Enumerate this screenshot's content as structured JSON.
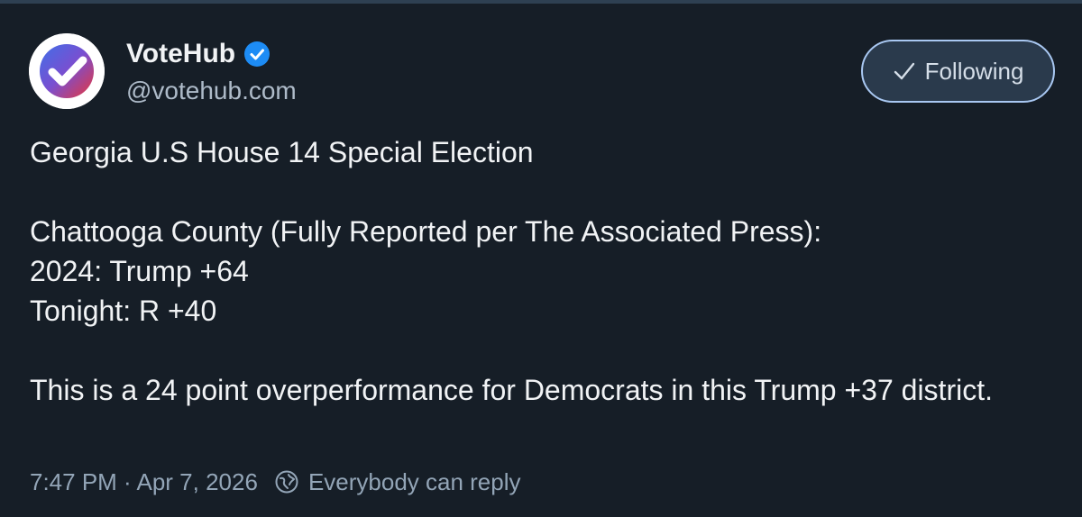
{
  "post": {
    "author": {
      "display_name": "VoteHub",
      "handle": "@votehub.com",
      "verified": true
    },
    "follow_button": {
      "label": "Following",
      "icon": "check-icon"
    },
    "text": {
      "line1": "Georgia U.S House 14 Special Election",
      "line2": "Chattooga County (Fully Reported per The Associated Press):",
      "line3": "2024: Trump +64",
      "line4": "Tonight: R +40",
      "line5": "This is a 24 point overperformance for Democrats in this Trump +37 district."
    },
    "meta": {
      "timestamp": "7:47 PM · Apr 7, 2026",
      "reply_setting": "Everybody can reply",
      "reply_icon": "reply-settings-icon"
    }
  },
  "colors": {
    "background": "#161e27",
    "text_primary": "#f1f3f5",
    "text_secondary": "#93a5b7",
    "verified_blue": "#1d8cf5",
    "follow_border": "#a9c8f2",
    "follow_bg": "#2a3a4c"
  }
}
